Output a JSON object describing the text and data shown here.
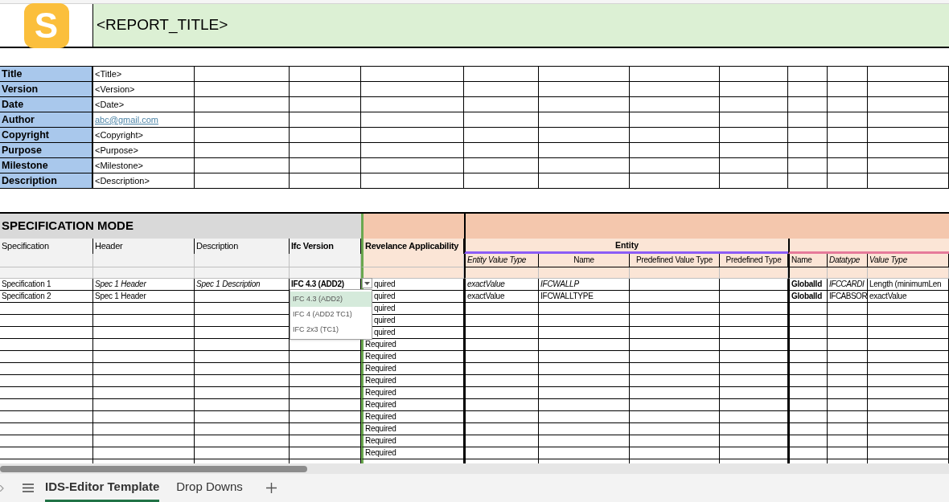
{
  "logo": {
    "letter": "S"
  },
  "report": {
    "title": "<REPORT_TITLE>"
  },
  "metadata": [
    {
      "label": "Title",
      "value": "<Title>",
      "kind": "text"
    },
    {
      "label": "Version",
      "value": "<Version>",
      "kind": "text"
    },
    {
      "label": "Date",
      "value": "<Date>",
      "kind": "text"
    },
    {
      "label": "Author",
      "value": "abc@gmail.com",
      "kind": "link"
    },
    {
      "label": "Copyright",
      "value": "<Copyright>",
      "kind": "text"
    },
    {
      "label": "Purpose",
      "value": "<Purpose>",
      "kind": "text"
    },
    {
      "label": "Milestone",
      "value": "<Milestone>",
      "kind": "text"
    },
    {
      "label": "Description",
      "value": "<Description>",
      "kind": "text"
    }
  ],
  "specification": {
    "title": "SPECIFICATION MODE",
    "columns": [
      {
        "label": "Specification",
        "bold": false
      },
      {
        "label": "Header",
        "bold": false
      },
      {
        "label": "Description",
        "bold": false
      },
      {
        "label": "Ifc Version",
        "bold": true
      },
      {
        "label": "Revelance Applicability",
        "bold": true
      }
    ],
    "entity_group": "Entity",
    "entity_columns": [
      {
        "label": "Entity Value Type",
        "italic": true
      },
      {
        "label": "Name",
        "italic": false
      },
      {
        "label": "Predefined Value Type",
        "italic": false
      },
      {
        "label": "Predefined Type",
        "italic": false
      }
    ],
    "property_columns": [
      {
        "label": "Name",
        "italic": false
      },
      {
        "label": "Datatype",
        "italic": true
      },
      {
        "label": "Value Type",
        "italic": true
      }
    ],
    "rows": [
      {
        "cells": [
          {
            "text": "Specification 1",
            "italic": false,
            "bold": false
          },
          {
            "text": "Spec 1 Header",
            "italic": true,
            "bold": false
          },
          {
            "text": "Spec 1 Description",
            "italic": true,
            "bold": false
          },
          {
            "text": "IFC 4.3 (ADD2)",
            "italic": false,
            "bold": true
          },
          {
            "text": "quired",
            "italic": false,
            "bold": false
          },
          {
            "text": "exactValue",
            "italic": true,
            "bold": false
          },
          {
            "text": "IFCWALLP",
            "italic": true,
            "bold": false
          },
          null,
          null,
          {
            "text": "GlobalId",
            "italic": false,
            "bold": true
          },
          {
            "text": "IFCCARDI",
            "italic": true,
            "bold": false
          },
          {
            "text": "Length (minimumLen",
            "italic": false,
            "bold": false
          }
        ]
      },
      {
        "cells": [
          {
            "text": "Specification 2",
            "italic": false,
            "bold": false
          },
          {
            "text": "Spec 1 Header",
            "italic": false,
            "bold": false
          },
          null,
          null,
          {
            "text": "quired",
            "italic": false,
            "bold": false
          },
          {
            "text": "exactValue",
            "italic": false,
            "bold": false
          },
          {
            "text": "IFCWALLTYPE",
            "italic": false,
            "bold": false
          },
          null,
          null,
          {
            "text": "GlobalId",
            "italic": false,
            "bold": true
          },
          {
            "text": "IFCABSOR",
            "italic": false,
            "bold": false
          },
          {
            "text": "exactValue",
            "italic": false,
            "bold": false
          }
        ]
      },
      {
        "cells": [
          null,
          null,
          null,
          null,
          {
            "text": "quired",
            "italic": false,
            "bold": false
          }
        ]
      },
      {
        "cells": [
          null,
          null,
          null,
          null,
          {
            "text": "quired",
            "italic": false,
            "bold": false
          }
        ]
      },
      {
        "cells": [
          null,
          null,
          null,
          null,
          {
            "text": "quired",
            "italic": false,
            "bold": false
          }
        ]
      },
      {
        "cells": [
          null,
          null,
          null,
          null,
          {
            "text": "Required",
            "italic": false,
            "bold": false
          }
        ]
      },
      {
        "cells": [
          null,
          null,
          null,
          null,
          {
            "text": "Required",
            "italic": false,
            "bold": false
          }
        ]
      },
      {
        "cells": [
          null,
          null,
          null,
          null,
          {
            "text": "Required",
            "italic": false,
            "bold": false
          }
        ]
      },
      {
        "cells": [
          null,
          null,
          null,
          null,
          {
            "text": "Required",
            "italic": false,
            "bold": false
          }
        ]
      },
      {
        "cells": [
          null,
          null,
          null,
          null,
          {
            "text": "Required",
            "italic": false,
            "bold": false
          }
        ]
      },
      {
        "cells": [
          null,
          null,
          null,
          null,
          {
            "text": "Required",
            "italic": false,
            "bold": false
          }
        ]
      },
      {
        "cells": [
          null,
          null,
          null,
          null,
          {
            "text": "Required",
            "italic": false,
            "bold": false
          }
        ]
      },
      {
        "cells": [
          null,
          null,
          null,
          null,
          {
            "text": "Required",
            "italic": false,
            "bold": false
          }
        ]
      },
      {
        "cells": [
          null,
          null,
          null,
          null,
          {
            "text": "Required",
            "italic": false,
            "bold": false
          }
        ]
      },
      {
        "cells": [
          null,
          null,
          null,
          null,
          {
            "text": "Required",
            "italic": false,
            "bold": false
          }
        ]
      }
    ],
    "dropdown": {
      "options": [
        {
          "label": "IFC 4.3 (ADD2)",
          "selected": true
        },
        {
          "label": "IFC 4 (ADD2 TC1)",
          "selected": false
        },
        {
          "label": "IFC 2x3 (TC1)",
          "selected": false
        }
      ]
    }
  },
  "sheet_tabs": [
    {
      "label": "IDS-Editor Template",
      "selected": true
    },
    {
      "label": "Drop Downs",
      "selected": false
    }
  ]
}
